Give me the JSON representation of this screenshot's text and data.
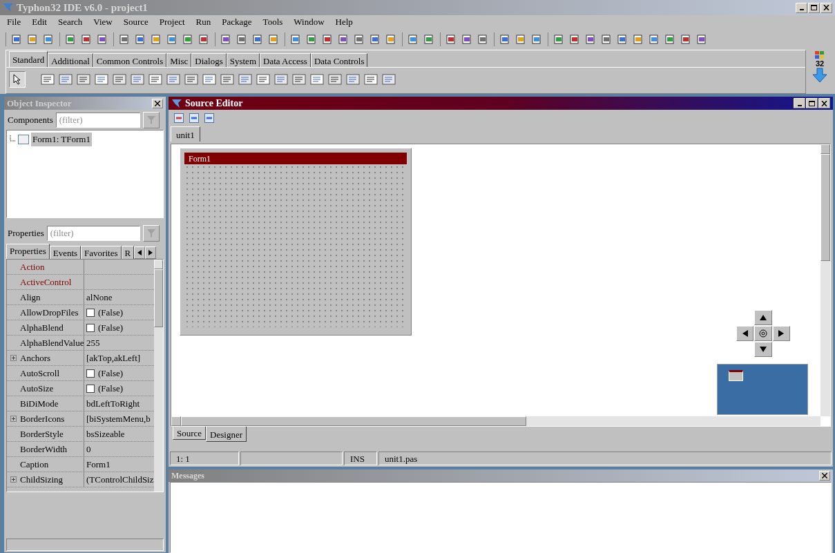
{
  "window": {
    "title": "Typhon32 IDE v6.0 - project1"
  },
  "menu": [
    "File",
    "Edit",
    "Search",
    "View",
    "Source",
    "Project",
    "Run",
    "Package",
    "Tools",
    "Window",
    "Help"
  ],
  "palette": {
    "tabs": [
      {
        "label": "Standard",
        "selected": true
      },
      {
        "label": "Additional",
        "selected": false
      },
      {
        "label": "Common Controls",
        "selected": false
      },
      {
        "label": "Misc",
        "selected": false
      },
      {
        "label": "Dialogs",
        "selected": false
      },
      {
        "label": "System",
        "selected": false
      },
      {
        "label": "Data Access",
        "selected": false
      },
      {
        "label": "Data Controls",
        "selected": false
      }
    ],
    "badge": "32"
  },
  "object_inspector": {
    "title": "Object Inspector",
    "components_label": "Components",
    "components_filter": {
      "placeholder": "(filter)"
    },
    "tree": [
      {
        "label": "Form1: TForm1",
        "selected": true
      }
    ],
    "properties_label": "Properties",
    "properties_filter": {
      "placeholder": "(filter)"
    },
    "tabs": [
      {
        "label": "Properties",
        "selected": true
      },
      {
        "label": "Events",
        "selected": false
      },
      {
        "label": "Favorites",
        "selected": false
      },
      {
        "label": "R",
        "selected": false
      }
    ],
    "rows": [
      {
        "name": "Action",
        "kind": "reference"
      },
      {
        "name": "ActiveControl",
        "kind": "reference"
      },
      {
        "name": "Align",
        "value": "alNone",
        "kind": "text"
      },
      {
        "name": "AllowDropFiles",
        "value": "(False)",
        "kind": "checkbox",
        "checked": false
      },
      {
        "name": "AlphaBlend",
        "value": "(False)",
        "kind": "checkbox",
        "checked": false
      },
      {
        "name": "AlphaBlendValue",
        "value": "255",
        "kind": "text"
      },
      {
        "name": "Anchors",
        "value": "[akTop,akLeft]",
        "kind": "set"
      },
      {
        "name": "AutoScroll",
        "value": "(False)",
        "kind": "checkbox",
        "checked": false
      },
      {
        "name": "AutoSize",
        "value": "(False)",
        "kind": "checkbox",
        "checked": false
      },
      {
        "name": "BiDiMode",
        "value": "bdLeftToRight",
        "kind": "text"
      },
      {
        "name": "BorderIcons",
        "value": "[biSystemMenu,b",
        "kind": "set"
      },
      {
        "name": "BorderStyle",
        "value": "bsSizeable",
        "kind": "text"
      },
      {
        "name": "BorderWidth",
        "value": "0",
        "kind": "text"
      },
      {
        "name": "Caption",
        "value": "Form1",
        "kind": "text"
      },
      {
        "name": "ChildSizing",
        "value": "(TControlChildSiz",
        "kind": "set"
      }
    ]
  },
  "source_editor": {
    "title": "Source Editor",
    "tabs": [
      {
        "label": "unit1",
        "selected": true
      }
    ],
    "form_caption": "Form1",
    "bottom_tabs": [
      {
        "label": "Source",
        "selected": false
      },
      {
        "label": "Designer",
        "selected": true
      }
    ],
    "status_bar": [
      "1:  1",
      "INS",
      "unit1.pas"
    ]
  },
  "messages": {
    "title": "Messages"
  }
}
